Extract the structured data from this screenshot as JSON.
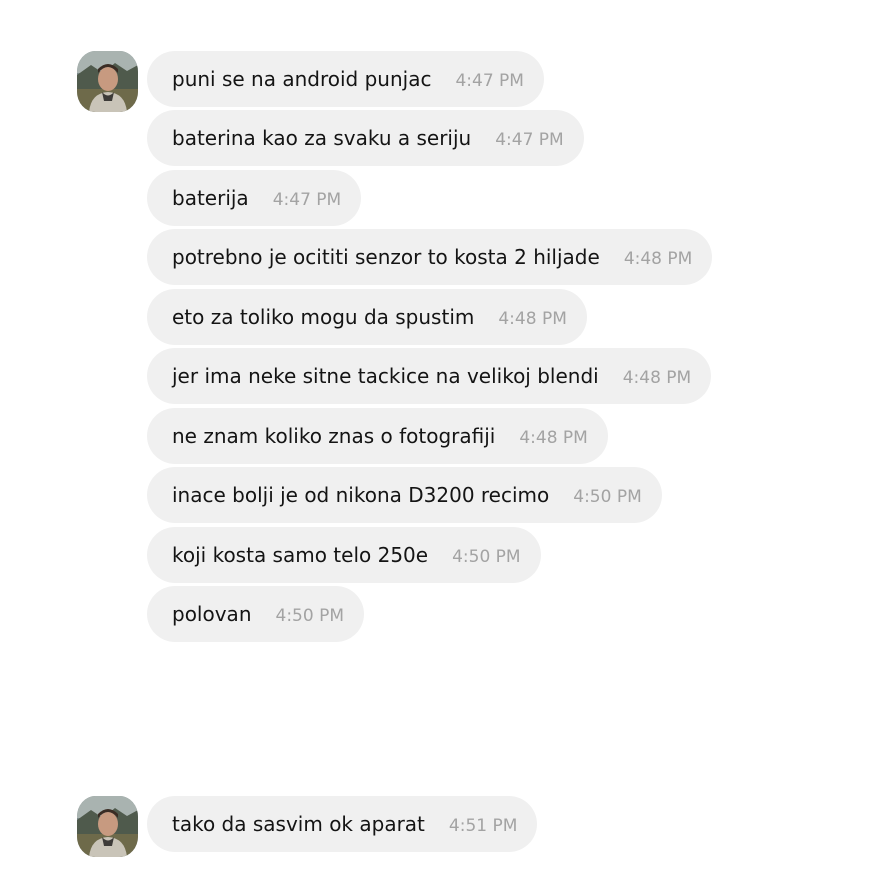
{
  "conversation": {
    "groups": [
      {
        "avatar": "profile-avatar",
        "messages": [
          {
            "text": "puni se na android punjac",
            "time": "4:47 PM"
          },
          {
            "text": "baterina kao za svaku a seriju",
            "time": "4:47 PM"
          },
          {
            "text": "baterija",
            "time": "4:47 PM"
          },
          {
            "text": "potrebno je ocititi senzor to kosta 2 hiljade",
            "time": "4:48 PM"
          },
          {
            "text": "eto za toliko mogu da spustim",
            "time": "4:48 PM"
          },
          {
            "text": "jer ima neke sitne tackice na velikoj blendi",
            "time": "4:48 PM"
          },
          {
            "text": "ne znam koliko znas o fotografiji",
            "time": "4:48 PM"
          },
          {
            "text": "inace bolji je od nikona D3200 recimo",
            "time": "4:50 PM"
          },
          {
            "text": "koji kosta samo telo 250e",
            "time": "4:50 PM"
          },
          {
            "text": "polovan",
            "time": "4:50 PM"
          }
        ]
      },
      {
        "avatar": "profile-avatar",
        "messages": [
          {
            "text": "tako da sasvim ok aparat",
            "time": "4:51 PM"
          }
        ]
      }
    ]
  },
  "colors": {
    "bubble_bg": "#f0f0f0",
    "text": "#141414",
    "time": "#a3a3a3",
    "background": "#ffffff"
  }
}
